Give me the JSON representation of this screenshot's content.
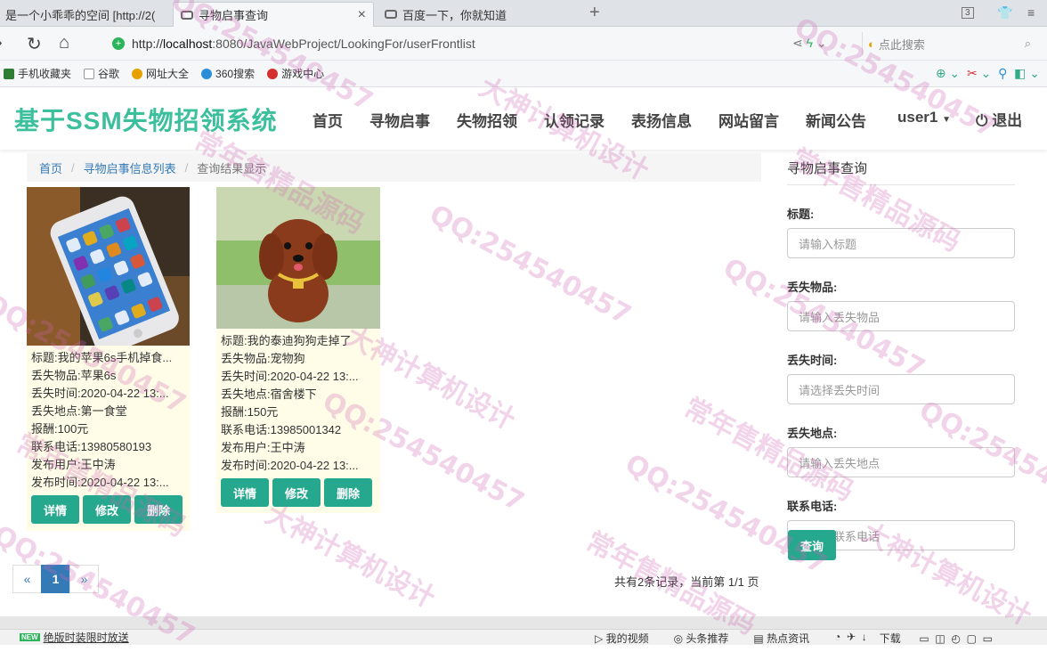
{
  "browser": {
    "tabs": [
      {
        "title": "是一个小乖乖的空间 [http://2("
      },
      {
        "title": "寻物启事查询"
      },
      {
        "title": "百度一下，你就知道"
      }
    ],
    "new_tab": "+",
    "tab_count": "3",
    "url_protocol": "http://",
    "url_host": "localhost",
    "url_path": ":8080/JavaWebProject/LookingFor/userFrontlist",
    "search_placeholder": "点此搜索",
    "bookmarks": [
      {
        "label": "手机收藏夹",
        "color": "#2e7d32"
      },
      {
        "label": "谷歌",
        "color": "#cccccc"
      },
      {
        "label": "网址大全",
        "color": "#e6a100"
      },
      {
        "label": "360搜索",
        "color": "#2a8fd8"
      },
      {
        "label": "游戏中心",
        "color": "#d32f2f"
      }
    ]
  },
  "site": {
    "brand": "基于SSM失物招领系统",
    "nav": [
      "首页",
      "寻物启事",
      "失物招领",
      "认领记录",
      "表扬信息",
      "网站留言",
      "新闻公告"
    ],
    "user": "user1",
    "logout": "退出"
  },
  "breadcrumb": {
    "home": "首页",
    "list": "寻物启事信息列表",
    "current": "查询结果显示"
  },
  "cards": [
    {
      "lines": [
        "标题:我的苹果6s手机掉食...",
        "丢失物品:苹果6s",
        "丢失时间:2020-04-22 13:...",
        "丢失地点:第一食堂",
        "报酬:100元",
        "联系电话:13980580193",
        "发布用户:王中涛",
        "发布时间:2020-04-22 13:..."
      ],
      "buttons": [
        "详情",
        "修改",
        "删除"
      ]
    },
    {
      "lines": [
        "标题:我的泰迪狗狗走掉了",
        "丢失物品:宠物狗",
        "丢失时间:2020-04-22 13:...",
        "丢失地点:宿舍楼下",
        "报酬:150元",
        "联系电话:13985001342",
        "发布用户:王中涛",
        "发布时间:2020-04-22 13:..."
      ],
      "buttons": [
        "详情",
        "修改",
        "删除"
      ]
    }
  ],
  "pagination": {
    "prev": "«",
    "current": "1",
    "next": "»",
    "summary": "共有2条记录，当前第 1/1 页"
  },
  "sidebar": {
    "title": "寻物启事查询",
    "fields": [
      {
        "label": "标题:",
        "placeholder": "请输入标题"
      },
      {
        "label": "丢失物品:",
        "placeholder": "请输入丢失物品"
      },
      {
        "label": "丢失时间:",
        "placeholder": "请选择丢失时间"
      },
      {
        "label": "丢失地点:",
        "placeholder": "请输入丢失地点"
      },
      {
        "label": "联系电话:",
        "placeholder": "请输入联系电话"
      }
    ],
    "query_button": "查询"
  },
  "statusbar": {
    "new_badge": "NEW",
    "left_text": "绝版时装限时放送",
    "right_items": [
      "我的视频",
      "头条推荐",
      "热点资讯",
      "下载"
    ]
  },
  "watermarks": [
    "QQ:254540457",
    "大神计算机设计",
    "常年售精品源码"
  ],
  "colors": {
    "brand": "#3bbf9c",
    "button": "#26a88e",
    "link": "#337ab7",
    "card_bg": "#fffde8"
  }
}
